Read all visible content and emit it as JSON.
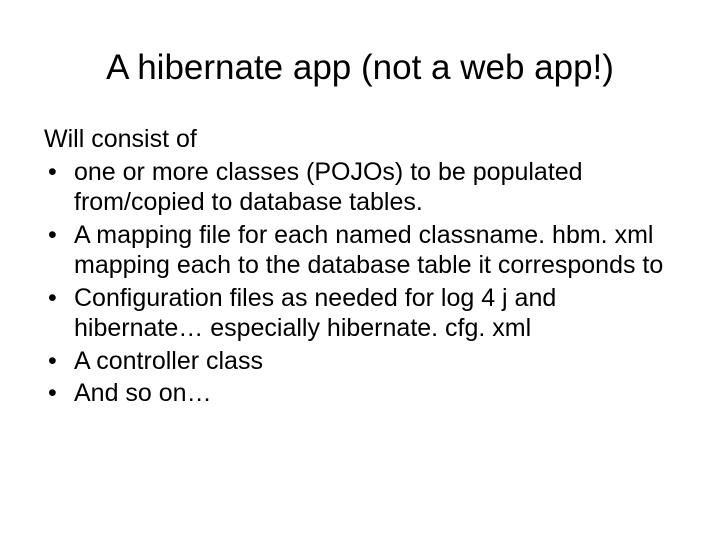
{
  "slide": {
    "title": "A hibernate app (not a web app!)",
    "lead": "Will consist of",
    "bullets": [
      "one or more classes (POJOs) to be populated from/copied to database tables.",
      "A mapping file for each named classname. hbm. xml mapping each to the database table it corresponds to",
      "Configuration files as needed for log 4 j and hibernate… especially hibernate. cfg. xml",
      "A controller class",
      "And so on…"
    ]
  }
}
